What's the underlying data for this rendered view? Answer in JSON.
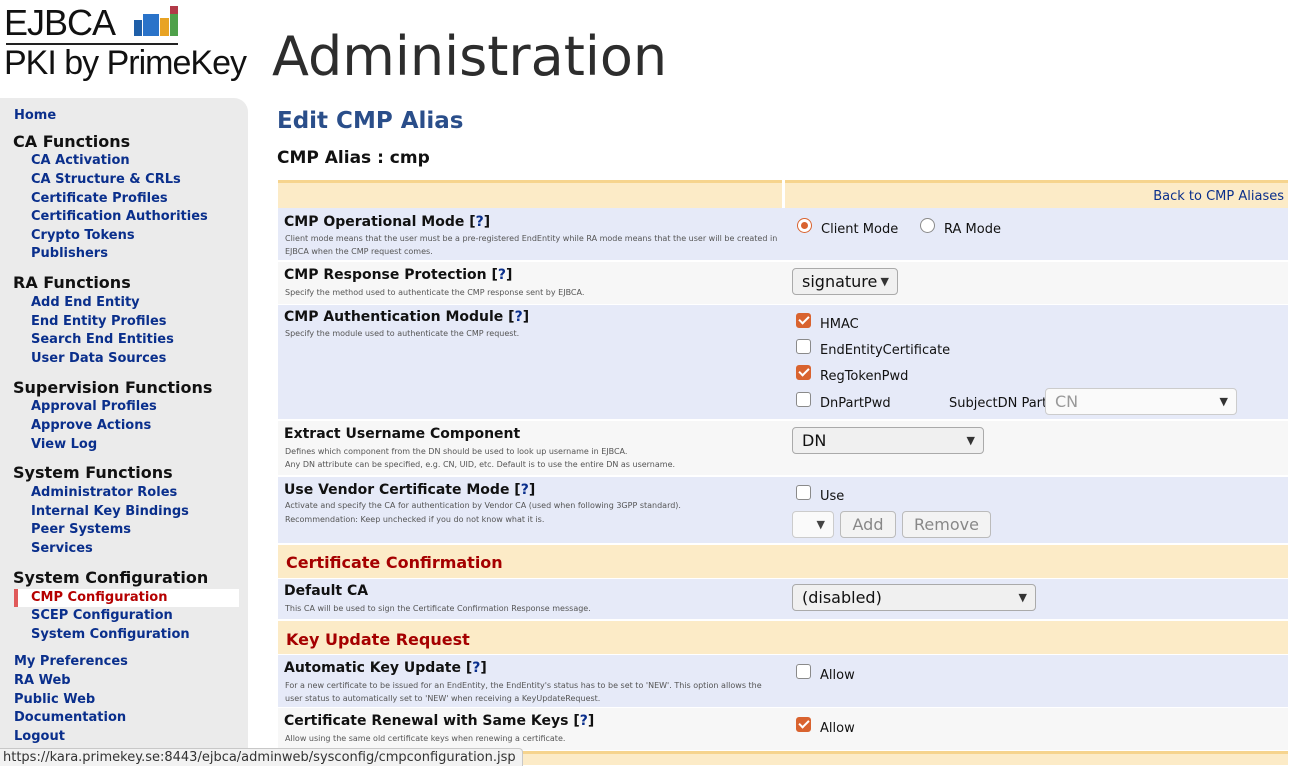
{
  "header": {
    "logo_top": "EJBCA",
    "logo_bottom": "PKI by PrimeKey",
    "app_title": "Administration"
  },
  "sidebar": {
    "home": "Home",
    "ca_functions": {
      "title": "CA Functions",
      "items": [
        "CA Activation",
        "CA Structure & CRLs",
        "Certificate Profiles",
        "Certification Authorities",
        "Crypto Tokens",
        "Publishers"
      ]
    },
    "ra_functions": {
      "title": "RA Functions",
      "items": [
        "Add End Entity",
        "End Entity Profiles",
        "Search End Entities",
        "User Data Sources"
      ]
    },
    "supervision_functions": {
      "title": "Supervision Functions",
      "items": [
        "Approval Profiles",
        "Approve Actions",
        "View Log"
      ]
    },
    "system_functions": {
      "title": "System Functions",
      "items": [
        "Administrator Roles",
        "Internal Key Bindings",
        "Peer Systems",
        "Services"
      ]
    },
    "system_configuration": {
      "title": "System Configuration",
      "items": [
        "CMP Configuration",
        "SCEP Configuration",
        "System Configuration"
      ],
      "active": "CMP Configuration"
    },
    "bottom_links": [
      "My Preferences",
      "RA Web",
      "Public Web",
      "Documentation",
      "Logout"
    ]
  },
  "main": {
    "page_title": "Edit CMP Alias",
    "alias_title": "CMP Alias : cmp",
    "back_link": "Back to CMP Aliases",
    "help_marker": "?",
    "rows": {
      "operational_mode": {
        "label": "CMP Operational Mode",
        "description": "Client mode means that the user must be a pre-registered EndEntity while RA mode means that the user will be created in EJBCA when the CMP request comes.",
        "options": [
          "Client Mode",
          "RA Mode"
        ],
        "selected": "Client Mode"
      },
      "response_protection": {
        "label": "CMP Response Protection",
        "description": "Specify the method used to authenticate the CMP response sent by EJBCA.",
        "value": "signature"
      },
      "authentication_module": {
        "label": "CMP Authentication Module",
        "description": "Specify the module used to authenticate the CMP request.",
        "options": [
          {
            "label": "HMAC",
            "checked": true
          },
          {
            "label": "EndEntityCertificate",
            "checked": false
          },
          {
            "label": "RegTokenPwd",
            "checked": true
          },
          {
            "label": "DnPartPwd",
            "checked": false
          }
        ],
        "subjectdn_label": "SubjectDN Part",
        "subjectdn_value": "CN"
      },
      "extract_username": {
        "label": "Extract Username Component",
        "description_1": "Defines which component from the DN should be used to look up username in EJBCA.",
        "description_2": "Any DN attribute can be specified, e.g. CN, UID, etc. Default is to use the entire DN as username.",
        "value": "DN"
      },
      "vendor_cert_mode": {
        "label": "Use Vendor Certificate Mode",
        "description_1": "Activate and specify the CA for authentication by Vendor CA (used when following 3GPP standard).",
        "description_2": "Recommendation: Keep unchecked if you do not know what it is.",
        "use_label": "Use",
        "use_checked": false,
        "add_label": "Add",
        "remove_label": "Remove"
      },
      "section_cert_confirmation": "Certificate Confirmation",
      "default_ca": {
        "label": "Default CA",
        "description": "This CA will be used to sign the Certificate Confirmation Response message.",
        "value": "(disabled)"
      },
      "section_key_update": "Key Update Request",
      "auto_key_update": {
        "label": "Automatic Key Update",
        "description": "For a new certificate to be issued for an EndEntity, the EndEntity's status has to be set to 'NEW'. This option allows the user status to automatically set to 'NEW' when receiving a KeyUpdateRequest.",
        "allow_label": "Allow",
        "checked": false
      },
      "renewal_same_keys": {
        "label": "Certificate Renewal with Same Keys",
        "description": "Allow using the same old certificate keys when renewing a certificate.",
        "allow_label": "Allow",
        "checked": true
      }
    }
  },
  "status_bar": "https://kara.primekey.se:8443/ejbca/adminweb/sysconfig/cmpconfiguration.jsp",
  "colors": {
    "link": "#0a2f8c",
    "section_header": "#a50000",
    "row_alt": "#e6eaf8",
    "row_section": "#fcebc7",
    "accent": "#d9632f"
  }
}
